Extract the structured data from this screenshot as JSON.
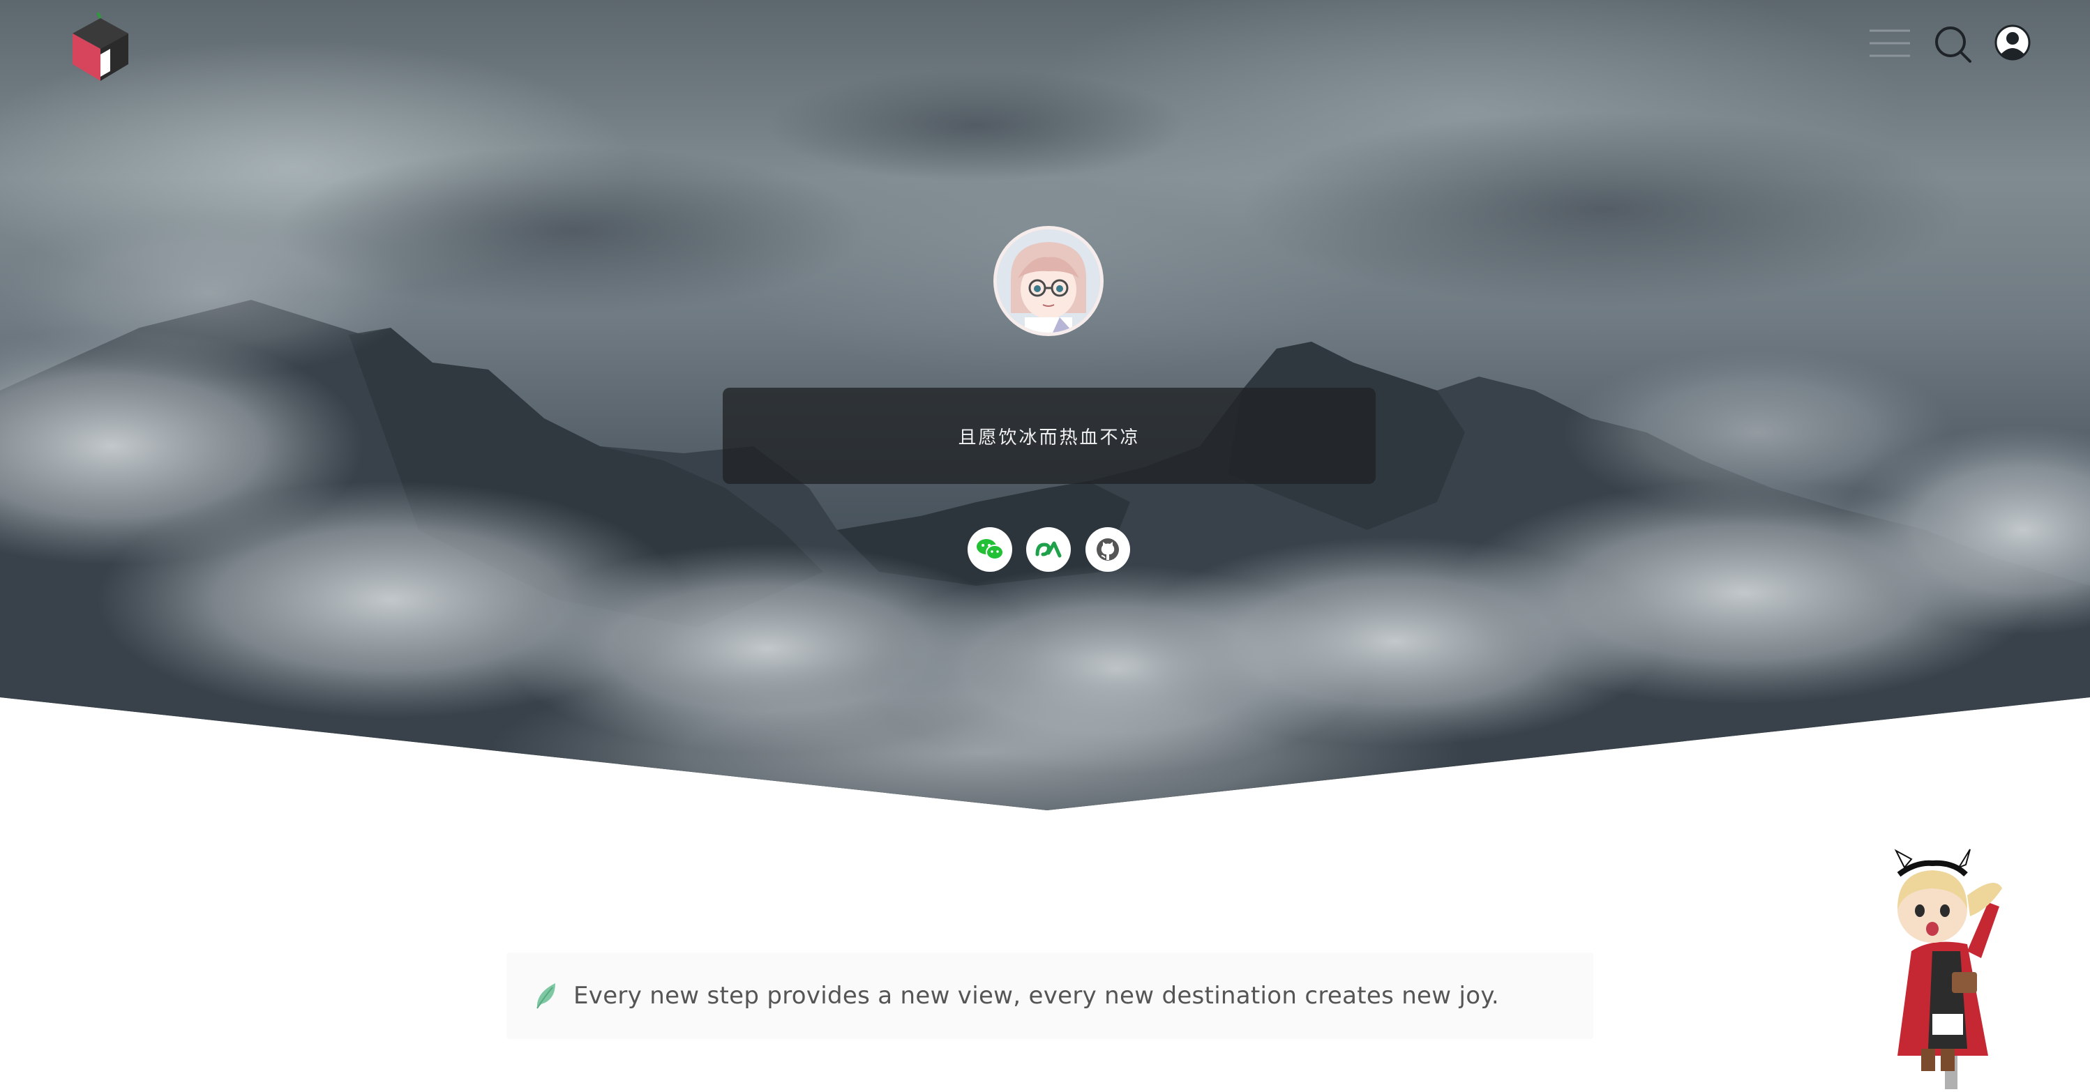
{
  "header": {
    "logo_icon": "cube-logo-icon",
    "menu_icon": "hamburger-menu-icon",
    "search_icon": "search-icon",
    "user_icon": "user-icon"
  },
  "profile": {
    "avatar_icon": "avatar-anime-girl",
    "motto": "且愿饮冰而热血不凉",
    "social_links": [
      {
        "name": "wechat",
        "icon": "wechat-icon",
        "color": "#22c035"
      },
      {
        "name": "acfun",
        "icon": "acfun-icon",
        "color": "#1fa04b"
      },
      {
        "name": "github",
        "icon": "github-icon",
        "color": "#555555"
      }
    ]
  },
  "notice": {
    "icon": "leaf-icon",
    "text": "Every new step provides a new view, every new destination creates new joy."
  },
  "mascot": {
    "icon": "live2d-mascot"
  },
  "colors": {
    "accent_green": "#7dc8a2",
    "motto_bg": "#202225"
  }
}
